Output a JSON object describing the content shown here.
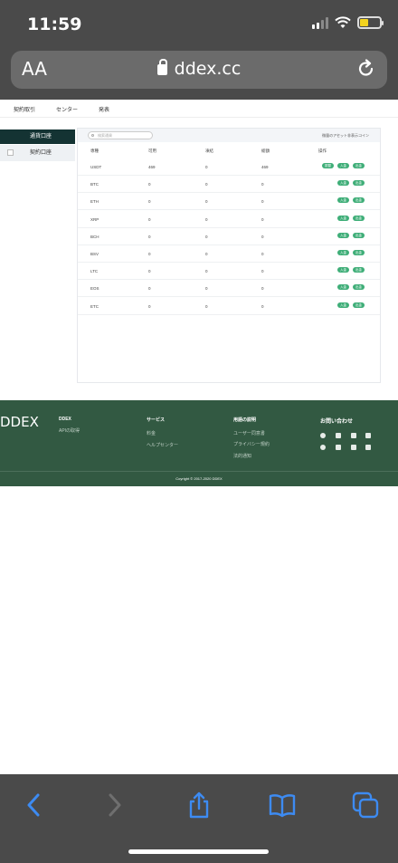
{
  "status_bar": {
    "time": "11:59"
  },
  "address_bar": {
    "aa_label": "AA",
    "url": "ddex.cc"
  },
  "site_nav": {
    "items": [
      "契約取引",
      "センター",
      "発表"
    ]
  },
  "sidebar": {
    "active": "通貨口座",
    "items": [
      "契約口座"
    ]
  },
  "panel": {
    "search_placeholder": "検索通貨",
    "hide_small": "微量のアセット非表示コイン",
    "columns": [
      "専種",
      "可用",
      "凍結",
      "総額",
      "操作"
    ],
    "rows": [
      {
        "coin": "USDT",
        "available": "469",
        "frozen": "0",
        "total": "469",
        "actions": [
          "振替",
          "入金",
          "出金"
        ]
      },
      {
        "coin": "BTC",
        "available": "0",
        "frozen": "0",
        "total": "0",
        "actions": [
          "入金",
          "出金"
        ]
      },
      {
        "coin": "ETH",
        "available": "0",
        "frozen": "0",
        "total": "0",
        "actions": [
          "入金",
          "出金"
        ]
      },
      {
        "coin": "XRP",
        "available": "0",
        "frozen": "0",
        "total": "0",
        "actions": [
          "入金",
          "出金"
        ]
      },
      {
        "coin": "BCH",
        "available": "0",
        "frozen": "0",
        "total": "0",
        "actions": [
          "入金",
          "出金"
        ]
      },
      {
        "coin": "BSV",
        "available": "0",
        "frozen": "0",
        "total": "0",
        "actions": [
          "入金",
          "出金"
        ]
      },
      {
        "coin": "LTC",
        "available": "0",
        "frozen": "0",
        "total": "0",
        "actions": [
          "入金",
          "出金"
        ]
      },
      {
        "coin": "EOS",
        "available": "0",
        "frozen": "0",
        "total": "0",
        "actions": [
          "入金",
          "出金"
        ]
      },
      {
        "coin": "ETC",
        "available": "0",
        "frozen": "0",
        "total": "0",
        "actions": [
          "入金",
          "出金"
        ]
      }
    ]
  },
  "footer": {
    "logo": "DDEX",
    "col1": {
      "title": "DDEX",
      "links": [
        "APIの取得"
      ]
    },
    "col2": {
      "title": "サービス",
      "links": [
        "料金",
        "ヘルプセンター"
      ]
    },
    "col3": {
      "title": "用語の説明",
      "links": [
        "ユーザー同意書",
        "プライバシー規約",
        "法的通知"
      ]
    },
    "col4": {
      "title": "お問い合わせ",
      "social_icons": [
        "weibo-icon",
        "facebook-icon",
        "telegram-icon",
        "youtube-icon",
        "reddit-icon",
        "medium-icon",
        "instagram-icon",
        "wechat-icon"
      ]
    },
    "copyright": "Coyright © 2017-2020 DDEX"
  },
  "colors": {
    "accent": "#3fae78",
    "footer_bg": "#325942",
    "sidebar_active": "#143333",
    "chrome": "#4a4a4a"
  }
}
